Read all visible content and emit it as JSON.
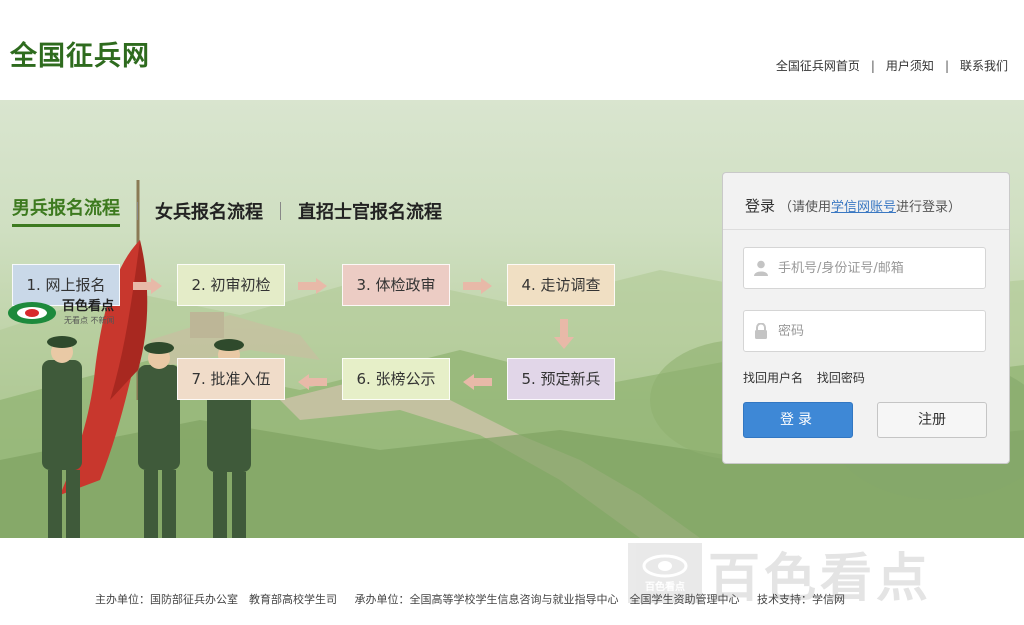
{
  "header": {
    "logo": "全国征兵网",
    "nav": [
      "全国征兵网首页",
      "用户须知",
      "联系我们"
    ],
    "nav_separator": "|"
  },
  "tabs": [
    "男兵报名流程",
    "女兵报名流程",
    "直招士官报名流程"
  ],
  "steps": [
    "1. 网上报名",
    "2. 初审初检",
    "3. 体检政审",
    "4. 走访调查",
    "5. 预定新兵",
    "6. 张榜公示",
    "7. 批准入伍"
  ],
  "watermark": {
    "small": "百色看点",
    "small_sub": "无看点 不新闻",
    "badge": "百色看点",
    "big": "百色看点"
  },
  "login": {
    "title": "登录",
    "hint_prefix": "（请使用",
    "hint_link": "学信网账号",
    "hint_suffix": "进行登录）",
    "username_placeholder": "手机号/身份证号/邮箱",
    "password_placeholder": "密码",
    "find_username": "找回用户名",
    "find_password": "找回密码",
    "login_button": "登录",
    "register_button": "注册"
  },
  "footer": {
    "host": "主办单位：国防部征兵办公室　教育部高校学生司",
    "organizer": "承办单位：全国高等学校学生信息咨询与就业指导中心　全国学生资助管理中心",
    "tech": "技术支持：学信网"
  },
  "colors": {
    "brand_green": "#2e6b1e",
    "active_tab": "#3d7a1f",
    "login_button": "#3e88d6",
    "link_blue": "#3a78c2"
  }
}
